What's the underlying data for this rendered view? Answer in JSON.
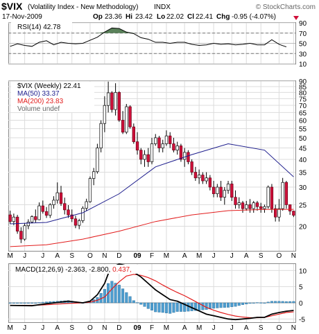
{
  "header": {
    "symbol": "$VIX",
    "name": "(Volatility Index - New Methodology)",
    "exchange": "INDX",
    "date": "17-Nov-2009",
    "op_label": "Op",
    "op": "23.36",
    "hi_label": "Hi",
    "hi": "23.42",
    "lo_label": "Lo",
    "lo": "22.02",
    "cl_label": "Cl",
    "cl": "22.41",
    "chg_label": "Chg",
    "chg": "-0.95 (-4.07%)",
    "copyright": "© StockCharts.com"
  },
  "colors": {
    "up": "#ffffff",
    "down": "#d0103a",
    "ma50": "#1c1c8c",
    "ma200": "#e21c1c",
    "rsi_line": "#000000",
    "rsi_fill": "#3d6b3d",
    "macd_line": "#000000",
    "signal_line": "#e21c1c",
    "histogram": "#4d9dcf",
    "grid": "#dcdcdc"
  },
  "chart_data": [
    {
      "type": "line",
      "panel": "RSI",
      "legend": "RSI(14) 42.78",
      "ylim": [
        10,
        90
      ],
      "y_ticks": [
        10,
        30,
        50,
        70,
        90
      ],
      "thresholds": [
        30,
        70
      ],
      "x": [
        0,
        2,
        4,
        6,
        8,
        10,
        12,
        14,
        16,
        18,
        20,
        22,
        24,
        26,
        28,
        30,
        32,
        34,
        36,
        38,
        40,
        42,
        44,
        46,
        48,
        50,
        52,
        54,
        56,
        58,
        60,
        62,
        64,
        66,
        68,
        70,
        72,
        74,
        76
      ],
      "values": [
        44,
        49,
        46,
        44,
        52,
        55,
        47,
        52,
        50,
        49,
        50,
        56,
        62,
        72,
        80,
        79,
        72,
        69,
        61,
        58,
        52,
        52,
        50,
        52,
        52,
        48,
        46,
        47,
        50,
        48,
        49,
        47,
        48,
        50,
        47,
        47,
        57,
        48,
        43
      ]
    },
    {
      "type": "candlestick",
      "panel": "price",
      "legend": [
        "$VIX (Weekly) 22.41",
        "MA(50) 33.37",
        "MA(200) 23.83",
        "Volume undef"
      ],
      "y_scale": "log",
      "ylim": [
        15.5,
        90
      ],
      "y_ticks": [
        20,
        25,
        30,
        35,
        40,
        45,
        50,
        55,
        60,
        65,
        70,
        75,
        80,
        85,
        90
      ],
      "x_ticks": [
        "M",
        "J",
        "J",
        "A",
        "S",
        "O",
        "N",
        "D",
        "09",
        "F",
        "M",
        "A",
        "M",
        "J",
        "J",
        "A",
        "S",
        "O",
        "N"
      ],
      "candles": [
        [
          0,
          22.5,
          23.5,
          20.5,
          21.0
        ],
        [
          1,
          21.0,
          22.8,
          20.2,
          22.0
        ],
        [
          2,
          22.0,
          22.5,
          18.5,
          19.0
        ],
        [
          3,
          19.0,
          19.8,
          16.8,
          17.5
        ],
        [
          4,
          17.5,
          20.6,
          17.2,
          20.1
        ],
        [
          5,
          20.1,
          21.5,
          19.4,
          20.9
        ],
        [
          6,
          20.9,
          22.4,
          20.6,
          22.1
        ],
        [
          7,
          22.1,
          23.8,
          20.8,
          21.4
        ],
        [
          8,
          21.4,
          25.6,
          21.3,
          24.7
        ],
        [
          9,
          24.7,
          26.1,
          22.8,
          23.3
        ],
        [
          10,
          23.3,
          24.4,
          21.8,
          22.4
        ],
        [
          11,
          22.4,
          25.4,
          21.8,
          25.0
        ],
        [
          12,
          25.0,
          27.3,
          24.0,
          26.2
        ],
        [
          13,
          26.2,
          31.5,
          25.3,
          28.3
        ],
        [
          14,
          28.3,
          30.4,
          24.7,
          25.3
        ],
        [
          15,
          25.3,
          26.9,
          22.6,
          23.7
        ],
        [
          16,
          23.7,
          24.9,
          21.8,
          22.5
        ],
        [
          17,
          22.5,
          23.8,
          20.9,
          21.6
        ],
        [
          18,
          21.6,
          22.3,
          19.6,
          20.2
        ],
        [
          19,
          20.2,
          21.6,
          19.4,
          21.2
        ],
        [
          20,
          21.2,
          24.6,
          20.7,
          24.1
        ],
        [
          21,
          24.1,
          26.6,
          23.5,
          25.8
        ],
        [
          22,
          25.8,
          33.5,
          25.5,
          32.8
        ],
        [
          23,
          32.8,
          36.6,
          30.6,
          35.2
        ],
        [
          24,
          35.2,
          47.0,
          34.5,
          45.0
        ],
        [
          25,
          45.0,
          59.9,
          43.0,
          58.0
        ],
        [
          26,
          58.0,
          76.9,
          53.0,
          69.9
        ],
        [
          27,
          69.9,
          89.5,
          65.0,
          79.7
        ],
        [
          28,
          79.7,
          81.0,
          65.0,
          67.0
        ],
        [
          29,
          67.0,
          88.0,
          63.0,
          80.0
        ],
        [
          30,
          80.0,
          81.0,
          59.0,
          60.0
        ],
        [
          31,
          60.0,
          66.0,
          52.0,
          53.0
        ],
        [
          32,
          53.0,
          71.0,
          52.0,
          69.0
        ],
        [
          33,
          69.0,
          70.0,
          55.0,
          56.0
        ],
        [
          34,
          56.0,
          58.0,
          47.0,
          48.0
        ],
        [
          35,
          48.0,
          53.0,
          42.0,
          44.0
        ],
        [
          36,
          44.0,
          45.0,
          38.0,
          40.0
        ],
        [
          37,
          40.0,
          44.0,
          37.0,
          42.0
        ],
        [
          38,
          42.0,
          45.0,
          37.0,
          39.0
        ],
        [
          39,
          39.0,
          50.0,
          38.0,
          47.0
        ],
        [
          40,
          47.0,
          52.0,
          46.0,
          50.0
        ],
        [
          41,
          50.0,
          51.0,
          43.0,
          45.0
        ],
        [
          42,
          45.0,
          49.0,
          43.0,
          47.0
        ],
        [
          43,
          47.0,
          54.0,
          46.0,
          51.0
        ],
        [
          44,
          51.0,
          53.0,
          45.0,
          47.0
        ],
        [
          45,
          47.0,
          50.0,
          43.0,
          44.0
        ],
        [
          46,
          44.0,
          48.0,
          42.0,
          46.0
        ],
        [
          47,
          46.0,
          47.0,
          39.0,
          40.0
        ],
        [
          48,
          40.0,
          45.0,
          37.0,
          43.0
        ],
        [
          49,
          43.0,
          44.0,
          38.0,
          39.0
        ],
        [
          50,
          39.0,
          40.0,
          34.0,
          35.0
        ],
        [
          51,
          35.0,
          37.0,
          32.0,
          33.0
        ],
        [
          52,
          33.0,
          36.0,
          31.0,
          34.0
        ],
        [
          53,
          34.0,
          35.0,
          31.0,
          32.0
        ],
        [
          54,
          32.0,
          35.0,
          31.0,
          33.0
        ],
        [
          55,
          33.0,
          34.0,
          29.0,
          30.0
        ],
        [
          56,
          30.0,
          32.0,
          27.0,
          28.0
        ],
        [
          57,
          28.0,
          31.0,
          27.0,
          30.0
        ],
        [
          58,
          30.0,
          32.0,
          26.0,
          27.0
        ],
        [
          59,
          27.0,
          30.0,
          25.0,
          29.0
        ],
        [
          60,
          29.0,
          32.0,
          28.0,
          31.0
        ],
        [
          61,
          31.0,
          32.0,
          26.0,
          27.0
        ],
        [
          62,
          27.0,
          29.0,
          24.0,
          25.0
        ],
        [
          63,
          25.0,
          27.0,
          24.0,
          25.5
        ],
        [
          64,
          25.5,
          26.0,
          23.0,
          24.0
        ],
        [
          65,
          24.0,
          26.0,
          23.5,
          25.0
        ],
        [
          66,
          25.0,
          26.5,
          23.0,
          24.0
        ],
        [
          67,
          24.0,
          26.0,
          23.0,
          25.5
        ],
        [
          68,
          25.5,
          26.0,
          23.5,
          24.5
        ],
        [
          69,
          24.5,
          25.5,
          23.0,
          24.0
        ],
        [
          70,
          24.0,
          25.0,
          23.0,
          24.5
        ],
        [
          71,
          24.5,
          30.5,
          24.0,
          30.0
        ],
        [
          72,
          30.0,
          31.0,
          23.0,
          24.0
        ],
        [
          73,
          24.0,
          25.0,
          21.0,
          22.0
        ],
        [
          74,
          22.0,
          26.5,
          21.0,
          24.0
        ],
        [
          75,
          24.0,
          33.0,
          23.5,
          31.5
        ],
        [
          76,
          31.5,
          32.0,
          24.0,
          25.0
        ],
        [
          77,
          25.0,
          25.0,
          22.5,
          23.4
        ],
        [
          78,
          23.4,
          23.5,
          22.0,
          22.4
        ]
      ],
      "ma50_x": [
        0,
        10,
        20,
        30,
        40,
        50,
        60,
        70,
        78
      ],
      "ma50": [
        20.5,
        20.8,
        23.0,
        28.0,
        37.0,
        42.0,
        47.0,
        44.0,
        33.37
      ],
      "ma200_x": [
        0,
        10,
        20,
        30,
        40,
        50,
        60,
        70,
        78
      ],
      "ma200": [
        16.2,
        16.5,
        17.5,
        19.0,
        21.0,
        22.5,
        23.5,
        23.8,
        23.83
      ]
    },
    {
      "type": "line",
      "panel": "MACD",
      "legend": "MACD(12,26,9) -2.363, -2.800, 0.437",
      "ylim": [
        -6,
        12
      ],
      "y_ticks": [
        -5,
        0,
        5,
        10
      ],
      "x": [
        0,
        6,
        10,
        16,
        20,
        22,
        24,
        26,
        27,
        28,
        30,
        32,
        34,
        36,
        38,
        40,
        42,
        44,
        46,
        48,
        50,
        52,
        54,
        56,
        58,
        60,
        62,
        64,
        66,
        68,
        70,
        72,
        74,
        76,
        78
      ],
      "macd": [
        -0.8,
        -0.9,
        -0.3,
        0.5,
        0.0,
        0.5,
        2.5,
        6.0,
        9.0,
        11.0,
        12.0,
        11.5,
        9.5,
        8.0,
        6.0,
        4.0,
        2.5,
        1.0,
        0.5,
        -0.5,
        -1.5,
        -2.5,
        -3.5,
        -4.0,
        -4.5,
        -5.0,
        -5.2,
        -5.0,
        -4.8,
        -4.5,
        -4.5,
        -3.5,
        -3.0,
        -2.6,
        -2.363
      ],
      "signal": [
        -0.8,
        -0.8,
        -0.6,
        -0.2,
        0.0,
        0.2,
        0.8,
        1.8,
        3.0,
        4.3,
        6.5,
        8.3,
        8.8,
        8.5,
        7.8,
        6.8,
        5.5,
        4.3,
        3.2,
        2.2,
        1.0,
        -0.2,
        -1.4,
        -2.3,
        -3.0,
        -3.6,
        -4.1,
        -4.4,
        -4.6,
        -4.6,
        -4.5,
        -4.0,
        -3.5,
        -3.0,
        -2.8
      ]
    }
  ]
}
